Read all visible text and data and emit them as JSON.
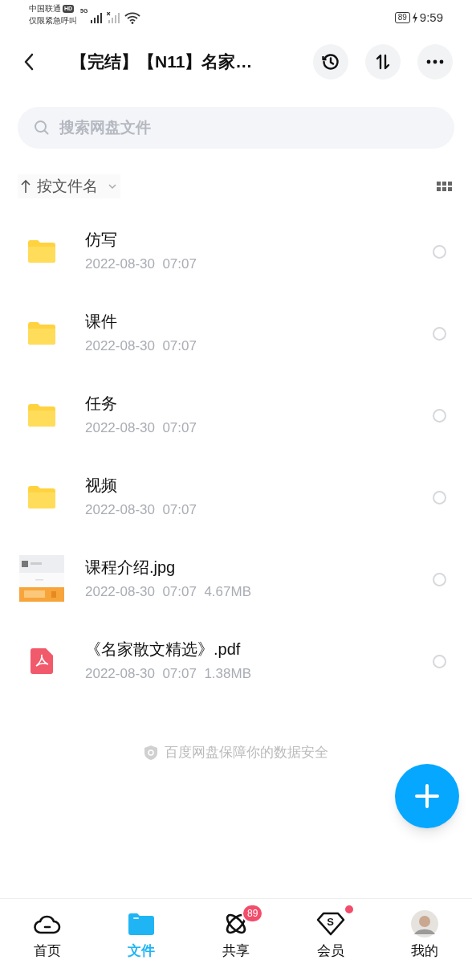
{
  "status_bar": {
    "carrier": "中国联通",
    "hd_badge": "HD",
    "emergency": "仅限紧急呼叫",
    "network": "5G",
    "battery": "89",
    "time": "9:59"
  },
  "header": {
    "title": "【完结】【N11】名家…"
  },
  "search": {
    "placeholder": "搜索网盘文件"
  },
  "sort": {
    "label": "按文件名"
  },
  "files": [
    {
      "kind": "folder",
      "name": "仿写",
      "date": "2022-08-30  07:07",
      "selected": false
    },
    {
      "kind": "folder",
      "name": "课件",
      "date": "2022-08-30  07:07",
      "selected": false
    },
    {
      "kind": "folder",
      "name": "任务",
      "date": "2022-08-30  07:07",
      "selected": false
    },
    {
      "kind": "folder",
      "name": "视频",
      "date": "2022-08-30  07:07",
      "selected": false
    },
    {
      "name": "课程介绍.jpg",
      "date": "2022-08-30  07:07",
      "size": "4.67MB",
      "selected": false
    },
    {
      "kind": "pdf",
      "name": "《名家散文精选》.pdf",
      "date": "2022-08-30  07:07",
      "size": "1.38MB",
      "selected": false
    }
  ],
  "footer_note": "百度网盘保障你的数据安全",
  "nav": [
    {
      "kind": "home",
      "label": "首页",
      "selected": false
    },
    {
      "kind": "files",
      "label": "文件",
      "selected": true
    },
    {
      "kind": "share",
      "label": "共享",
      "selected": false,
      "badge": "89"
    },
    {
      "kind": "vip",
      "label": "会员",
      "selected": false,
      "icon_text": "S",
      "dot": true
    },
    {
      "kind": "me",
      "label": "我的",
      "selected": false
    }
  ]
}
